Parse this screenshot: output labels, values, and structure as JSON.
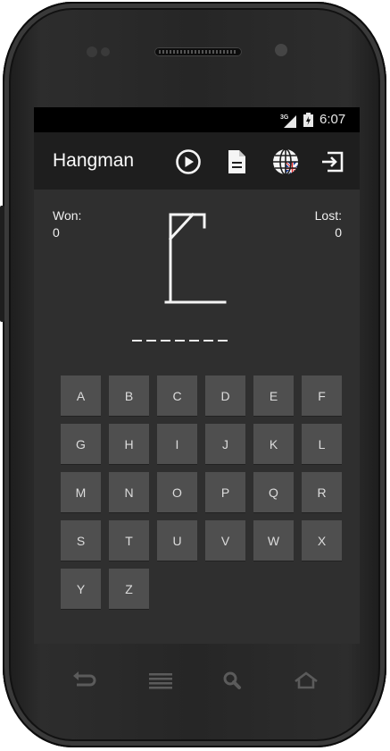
{
  "status_bar": {
    "network_label": "3G",
    "time": "6:07",
    "signal_icon": "signal-icon",
    "battery_icon": "battery-charging-icon"
  },
  "app_bar": {
    "title": "Hangman",
    "actions": [
      {
        "icon": "play-icon"
      },
      {
        "icon": "document-icon"
      },
      {
        "icon": "language-globe-icon"
      },
      {
        "icon": "exit-icon"
      }
    ]
  },
  "game": {
    "won_label": "Won:",
    "won_value": "0",
    "lost_label": "Lost:",
    "lost_value": "0",
    "word_length": 7,
    "keyboard": [
      "A",
      "B",
      "C",
      "D",
      "E",
      "F",
      "G",
      "H",
      "I",
      "J",
      "K",
      "L",
      "M",
      "N",
      "O",
      "P",
      "Q",
      "R",
      "S",
      "T",
      "U",
      "V",
      "W",
      "X",
      "Y",
      "Z"
    ]
  },
  "nav_bar": {
    "icons": [
      "back-icon",
      "menu-icon",
      "search-icon",
      "home-icon"
    ]
  },
  "colors": {
    "screen_bg": "#2f2f2f",
    "appbar_bg": "#1e1e1e",
    "key_bg": "#4f4f4f",
    "text": "#f0f0f0"
  }
}
